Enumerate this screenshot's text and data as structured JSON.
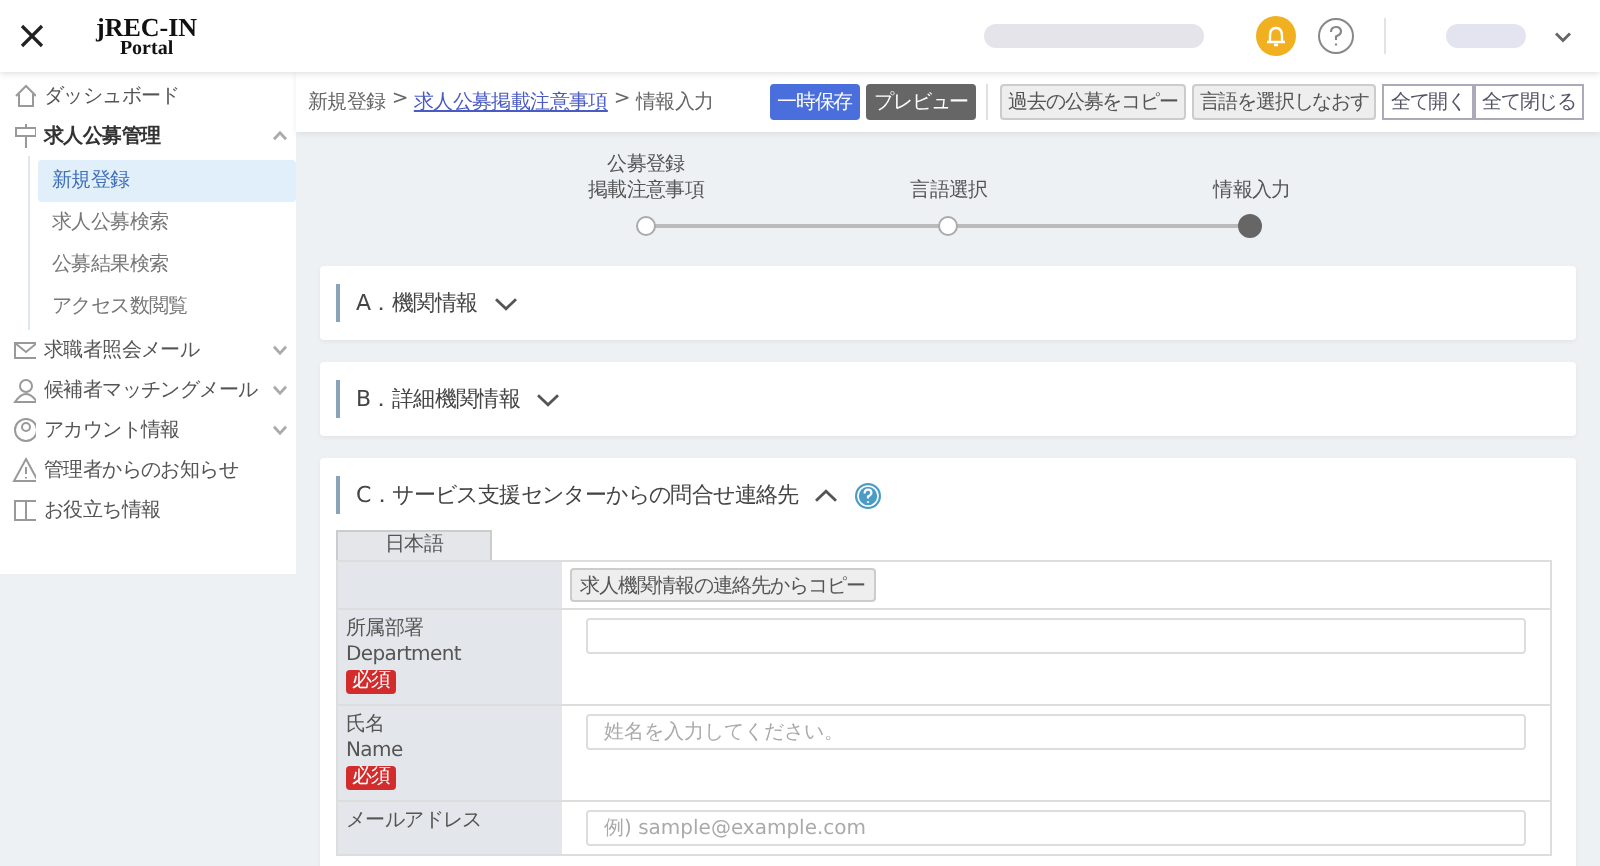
{
  "header": {
    "logo": {
      "title": "jREC-IN",
      "subtitle": "Portal"
    },
    "notifications": {
      "active": true
    }
  },
  "sidebar": {
    "items": [
      {
        "label": "ダッシュボード"
      },
      {
        "label": "求人公募管理",
        "expanded": true,
        "children": [
          {
            "label": "新規登録",
            "selected": true
          },
          {
            "label": "求人公募検索",
            "selected": false
          },
          {
            "label": "公募結果検索",
            "selected": false
          },
          {
            "label": "アクセス数閲覧",
            "selected": false
          }
        ]
      },
      {
        "label": "求職者照会メール",
        "expanded": false
      },
      {
        "label": "候補者マッチングメール",
        "expanded": false
      },
      {
        "label": "アカウント情報",
        "expanded": false
      },
      {
        "label": "管理者からのお知らせ"
      },
      {
        "label": "お役立ち情報"
      }
    ]
  },
  "breadcrumb": [
    {
      "label": "新規登録",
      "kind": "page"
    },
    {
      "label": ">",
      "kind": "separator"
    },
    {
      "label": "求人公募掲載注意事項",
      "kind": "link"
    },
    {
      "label": ">",
      "kind": "separator"
    },
    {
      "label": "情報入力",
      "kind": "page"
    }
  ],
  "toolbar": {
    "buttons": [
      {
        "label": "一時保存",
        "kind": "primary"
      },
      {
        "label": "プレビュー",
        "kind": "dark"
      },
      {
        "label": "過去の公募をコピー",
        "kind": "plain"
      },
      {
        "label": "言語を選択しなおす",
        "kind": "plain"
      },
      {
        "label": "全て開く",
        "kind": "outline"
      },
      {
        "label": "全て閉じる",
        "kind": "outline"
      }
    ]
  },
  "steps": [
    {
      "lines": [
        "公募登録",
        "掲載注意事項"
      ],
      "current": false
    },
    {
      "lines": [
        "言語選択"
      ],
      "current": false
    },
    {
      "lines": [
        "情報入力"
      ],
      "current": true
    }
  ],
  "sections": [
    {
      "title": "A．機関情報",
      "expanded": false
    },
    {
      "title": "B．詳細機関情報",
      "expanded": false
    },
    {
      "title": "C．サービス支援センターからの問合せ連絡先",
      "expanded": true,
      "help": true,
      "tabs": [
        {
          "label": "日本語",
          "selected": true
        }
      ],
      "rows": [
        {
          "kind": "action",
          "button": "求人機関情報の連絡先からコピー"
        },
        {
          "kind": "field",
          "label": "所属部署",
          "label_en": "Department",
          "required": true,
          "badge": "必須"
        },
        {
          "kind": "field",
          "label": "氏名",
          "label_en": "Name",
          "required": true,
          "badge": "必須",
          "placeholder": "姓名を入力してください。"
        },
        {
          "kind": "field",
          "label": "メールアドレス",
          "placeholder": "例) sample@example.com"
        }
      ]
    }
  ]
}
